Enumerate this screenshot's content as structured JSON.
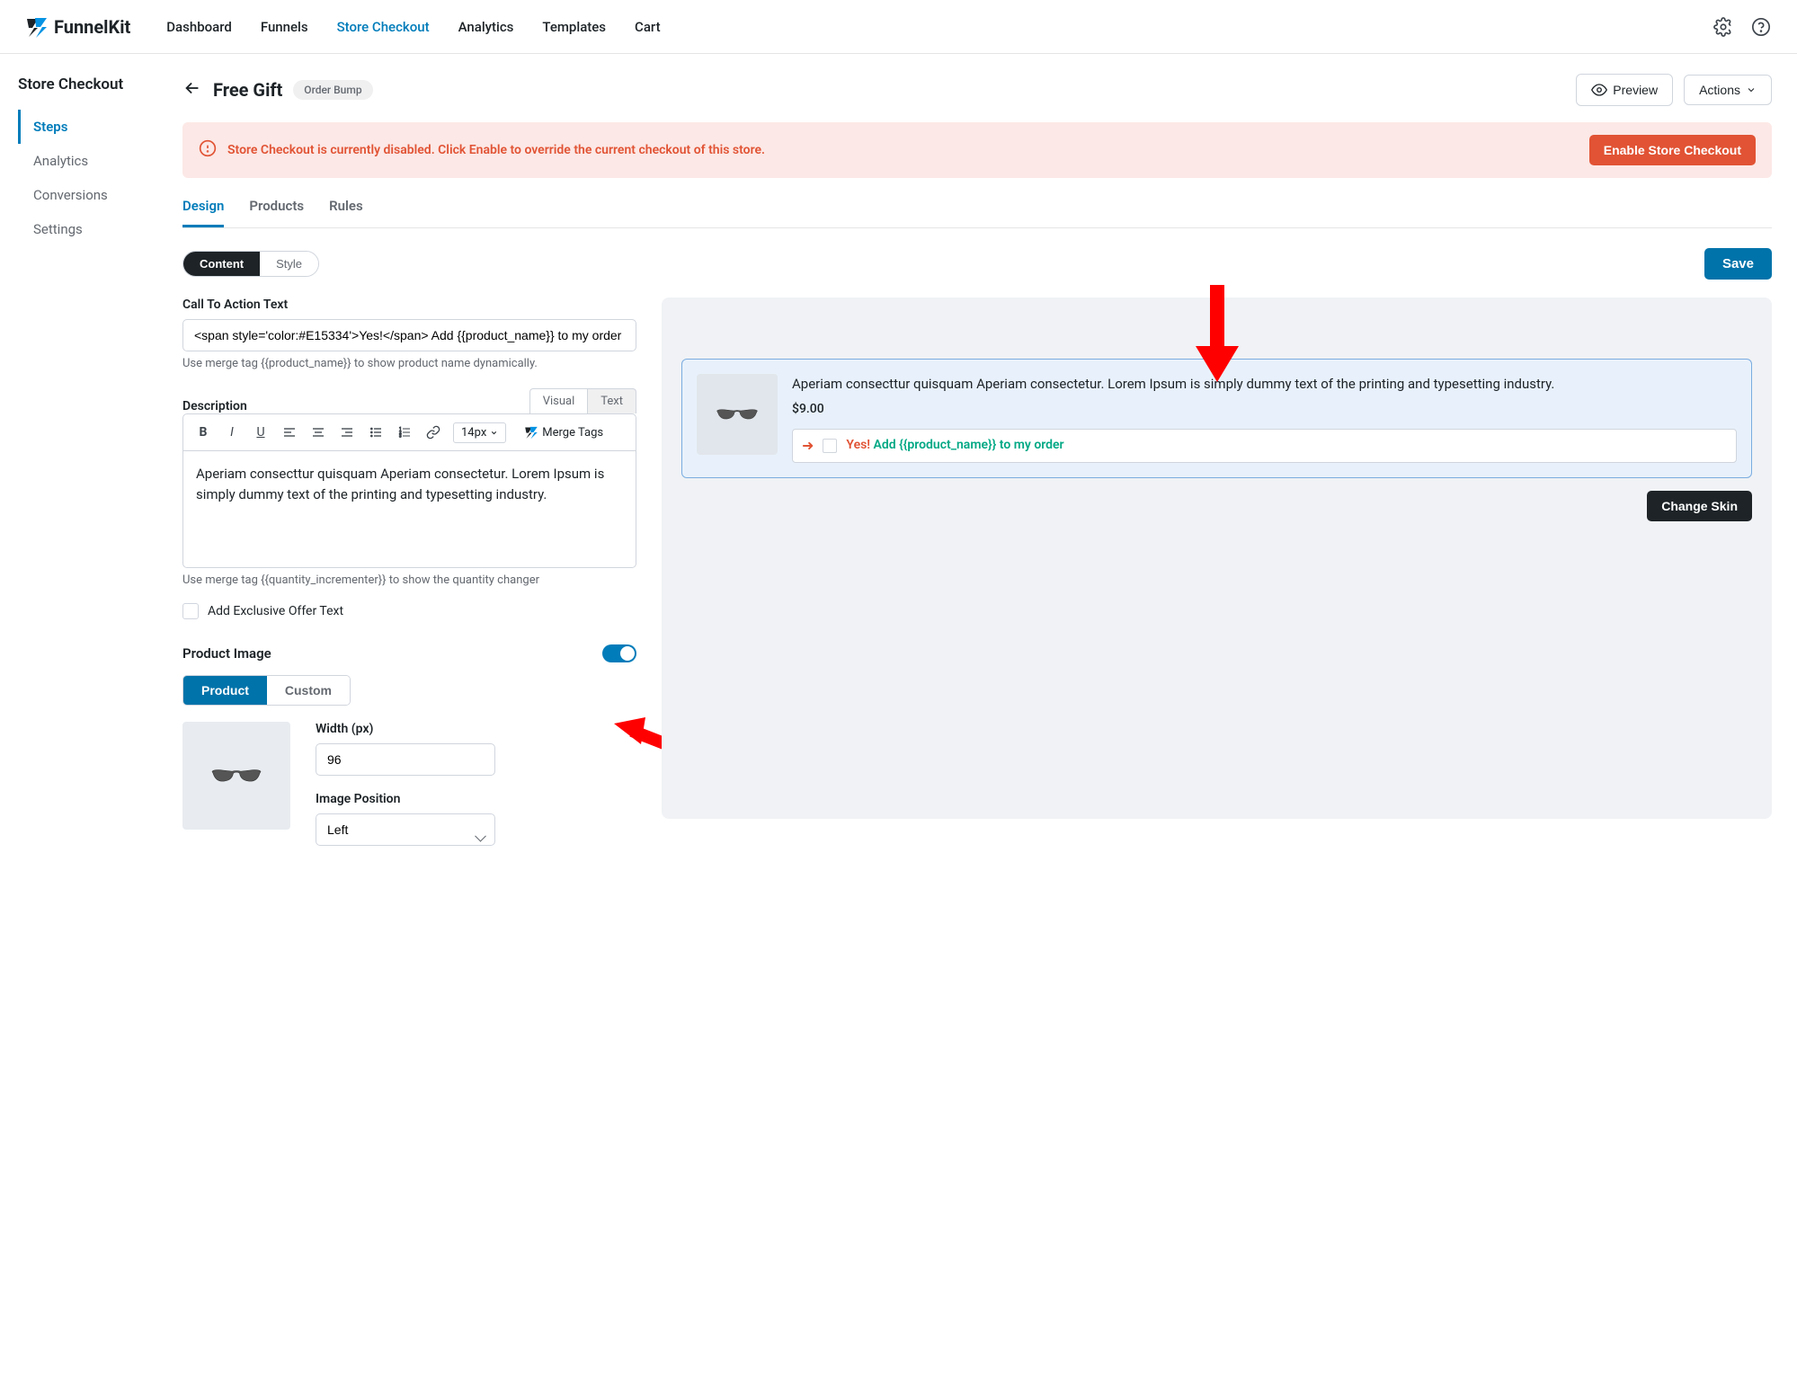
{
  "brand": "FunnelKit",
  "topnav": {
    "dashboard": "Dashboard",
    "funnels": "Funnels",
    "store_checkout": "Store Checkout",
    "analytics": "Analytics",
    "templates": "Templates",
    "cart": "Cart"
  },
  "sidebar": {
    "title": "Store Checkout",
    "items": [
      "Steps",
      "Analytics",
      "Conversions",
      "Settings"
    ],
    "active_index": 0
  },
  "page": {
    "title": "Free Gift",
    "badge": "Order Bump",
    "preview_btn": "Preview",
    "actions_btn": "Actions"
  },
  "alert": {
    "text": "Store Checkout is currently disabled. Click Enable to override the current checkout of this store.",
    "button": "Enable Store Checkout"
  },
  "tabs": {
    "design": "Design",
    "products": "Products",
    "rules": "Rules"
  },
  "segment": {
    "content": "Content",
    "style": "Style"
  },
  "save_label": "Save",
  "cta": {
    "label": "Call To Action Text",
    "value": "<span style='color:#E15334'>Yes!</span> Add {{product_name}} to my order",
    "help": "Use merge tag {{product_name}} to show product name dynamically."
  },
  "desc": {
    "label": "Description",
    "visual_tab": "Visual",
    "text_tab": "Text",
    "fontsize": "14px",
    "merge_tags": "Merge Tags",
    "content": "Aperiam consecttur quisquam Aperiam consectetur. Lorem Ipsum is simply dummy text of the printing and typesetting industry.",
    "help": "Use merge tag {{quantity_incrementer}} to show the quantity changer"
  },
  "exclusive": {
    "label": "Add Exclusive Offer Text"
  },
  "product_image": {
    "title": "Product Image",
    "product_btn": "Product",
    "custom_btn": "Custom",
    "width_label": "Width (px)",
    "width_value": "96",
    "position_label": "Image Position",
    "position_value": "Left"
  },
  "preview": {
    "desc": "Aperiam consecttur quisquam Aperiam consectetur. Lorem Ipsum is simply dummy text of the printing and typesetting industry.",
    "price": "$9.00",
    "cta_yes": "Yes!",
    "cta_rest": "Add {{product_name}} to my order",
    "change_skin": "Change Skin"
  }
}
